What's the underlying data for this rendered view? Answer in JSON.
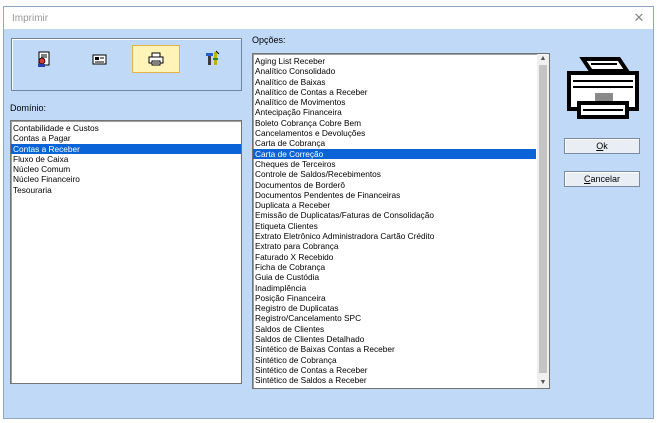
{
  "window": {
    "title": "Imprimir",
    "close_glyph": "✕"
  },
  "toolbar": {
    "buttons": [
      {
        "name": "user-report-icon",
        "active": false
      },
      {
        "name": "card-icon",
        "active": false
      },
      {
        "name": "printer-icon",
        "active": true
      },
      {
        "name": "tools-icon",
        "active": false
      }
    ]
  },
  "dominio": {
    "label": "Domínio:",
    "items": [
      "Contabilidade e Custos",
      "Contas a Pagar",
      "Contas a Receber",
      "Fluxo de Caixa",
      "Núcleo Comum",
      "Núcleo Financeiro",
      "Tesouraria"
    ],
    "selected": "Contas a Receber"
  },
  "opcoes": {
    "label": "Opções:",
    "items": [
      "Aging List Receber",
      "Analítico Consolidado",
      "Analítico de Baixas",
      "Analítico de Contas a Receber",
      "Analítico de Movimentos",
      "Antecipação Financeira",
      "Boleto Cobrança Cobre Bem",
      "Cancelamentos e Devoluções",
      "Carta de Cobrança",
      "Carta de Correção",
      "Cheques de Terceiros",
      "Controle de Saldos/Recebimentos",
      "Documentos de Borderô",
      "Documentos Pendentes de Financeiras",
      "Duplicata a Receber",
      "Emissão de Duplicatas/Faturas de Consolidação",
      "Etiqueta Clientes",
      "Extrato Eletrônico Administradora Cartão Crédito",
      "Extrato para Cobrança",
      "Faturado X Recebido",
      "Ficha de Cobrança",
      "Guia de Custódia",
      "Inadimplência",
      "Posição Financeira",
      "Registro de Duplicatas",
      "Registro/Cancelamento SPC",
      "Saldos de Clientes",
      "Saldos de Clientes Detalhado",
      "Sintético de Baixas Contas a Receber",
      "Sintético de Cobrança",
      "Sintético de Contas a Receber",
      "Sintético de Saldos a Receber"
    ],
    "selected": "Carta de Correção"
  },
  "buttons": {
    "ok": {
      "label": "Ok",
      "underline": "O",
      "rest": "k"
    },
    "cancel": {
      "label": "Cancelar",
      "underline": "C",
      "rest": "ancelar"
    }
  }
}
